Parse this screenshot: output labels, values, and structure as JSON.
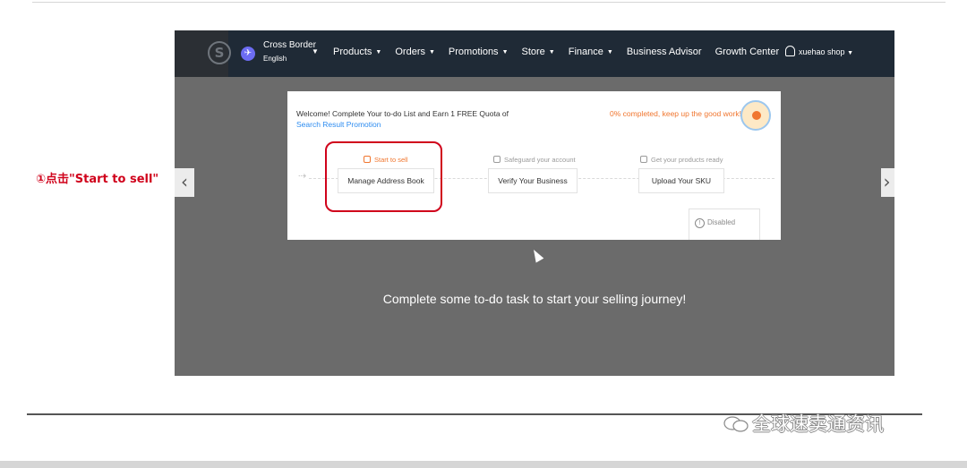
{
  "annotation": {
    "text": "①点击\"Start to sell\""
  },
  "navbar": {
    "logo_glyph": "S",
    "region": {
      "title": "Cross Border",
      "language": "English"
    },
    "menu": [
      {
        "label": "Products",
        "has_caret": true
      },
      {
        "label": "Orders",
        "has_caret": true
      },
      {
        "label": "Promotions",
        "has_caret": true
      },
      {
        "label": "Store",
        "has_caret": true
      },
      {
        "label": "Finance",
        "has_caret": true
      },
      {
        "label": "Business Advisor",
        "has_caret": false
      },
      {
        "label": "Growth Center",
        "has_caret": false
      }
    ],
    "user": {
      "name": "xuehao shop"
    }
  },
  "todo_card": {
    "welcome_text": "Welcome! Complete Your to-do List and Earn 1 FREE Quota of ",
    "welcome_link": "Search Result Promotion",
    "progress_text": "0% completed, keep up the good work!",
    "steps": [
      {
        "label": "Start to sell",
        "task": "Manage Address Book",
        "active": true
      },
      {
        "label": "Safeguard your account",
        "task": "Verify Your Business",
        "active": false
      },
      {
        "label": "Get your products ready",
        "task": "Upload Your SKU",
        "active": false
      }
    ],
    "disabled_label": "Disabled"
  },
  "cta_text": "Complete some to-do task to start your selling journey!",
  "carousel": {
    "prev_glyph": "‹",
    "next_glyph": "›"
  },
  "watermark": {
    "text": "全球速卖通资讯",
    "icon": "wechat-icon"
  },
  "colors": {
    "nav_bg": "#1f2a36",
    "accent_orange": "#f0762f",
    "link_blue": "#2d8cf0",
    "highlight_red": "#d0021b",
    "overlay_gray": "#6b6b6b"
  }
}
